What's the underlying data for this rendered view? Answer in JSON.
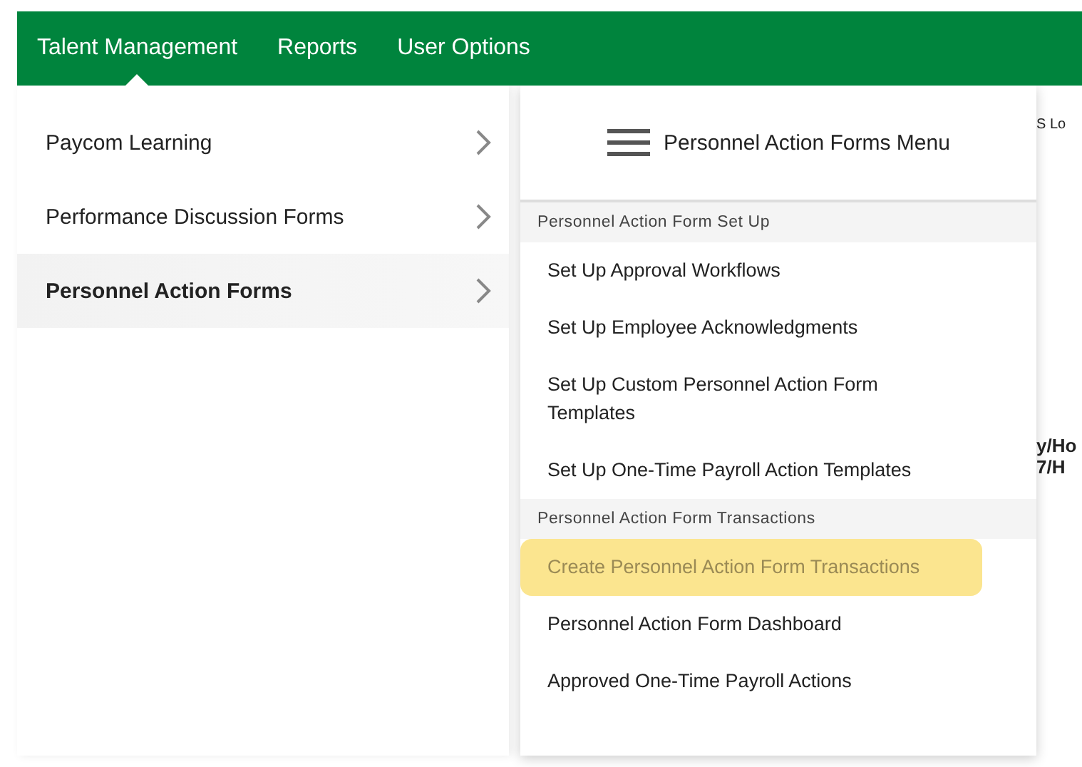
{
  "nav": [
    {
      "label": "Talent Management",
      "selected": true
    },
    {
      "label": "Reports",
      "selected": false
    },
    {
      "label": "User Options",
      "selected": false
    }
  ],
  "left_menu": [
    {
      "label": "Paycom Learning",
      "selected": false
    },
    {
      "label": "Performance Discussion Forms",
      "selected": false
    },
    {
      "label": "Personnel Action Forms",
      "selected": true
    }
  ],
  "submenu": {
    "title": "Personnel Action Forms Menu",
    "sections": [
      {
        "heading": "Personnel Action Form Set Up",
        "items": [
          {
            "label": "Set Up Approval Workflows",
            "highlighted": false
          },
          {
            "label": "Set Up Employee Acknowledgments",
            "highlighted": false
          },
          {
            "label": "Set Up Custom Personnel Action Form Templates",
            "highlighted": false
          },
          {
            "label": "Set Up One-Time Payroll Action Templates",
            "highlighted": false
          }
        ]
      },
      {
        "heading": "Personnel Action Form Transactions",
        "items": [
          {
            "label": "Create Personnel Action Form Transactions",
            "highlighted": true
          },
          {
            "label": "Personnel Action Form Dashboard",
            "highlighted": false
          },
          {
            "label": "Approved One-Time Payroll Actions",
            "highlighted": false
          }
        ]
      }
    ]
  },
  "background_fragments": [
    "S Lo",
    "y/Ho",
    "7/H"
  ]
}
